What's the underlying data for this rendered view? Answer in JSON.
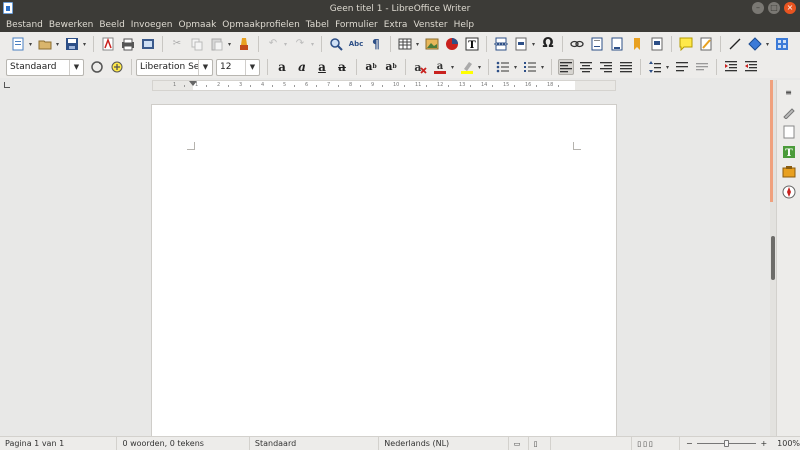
{
  "window": {
    "title": "Geen titel 1 - LibreOffice Writer",
    "controls": [
      "minimize",
      "maximize",
      "close"
    ]
  },
  "menubar": {
    "items": [
      "Bestand",
      "Bewerken",
      "Beeld",
      "Invoegen",
      "Opmaak",
      "Opmaakprofielen",
      "Tabel",
      "Formulier",
      "Extra",
      "Venster",
      "Help"
    ]
  },
  "toolbar_standard": {
    "icons": [
      "new-document-icon",
      "open-folder-icon",
      "save-icon",
      "export-pdf-icon",
      "print-icon",
      "print-preview-icon",
      "cut-icon",
      "copy-icon",
      "paste-icon",
      "clone-formatting-icon",
      "undo-icon",
      "redo-icon",
      "find-replace-icon",
      "spellcheck-icon",
      "formatting-marks-icon",
      "insert-table-icon",
      "insert-image-icon",
      "insert-chart-icon",
      "insert-textbox-icon",
      "page-break-icon",
      "insert-field-icon",
      "special-character-icon",
      "hyperlink-icon",
      "footnote-icon",
      "endnote-icon",
      "bookmark-icon",
      "cross-reference-icon",
      "comment-icon",
      "track-changes-icon",
      "line-icon",
      "basic-shapes-icon",
      "draw-functions-icon"
    ]
  },
  "toolbar_formatting": {
    "paragraph_style": "Standaard",
    "font_name": "Liberation Ser",
    "font_size": "12",
    "icons": [
      "update-style-icon",
      "new-style-icon",
      "bold-icon",
      "italic-icon",
      "underline-icon",
      "strikethrough-icon",
      "superscript-icon",
      "subscript-icon",
      "clear-formatting-icon",
      "font-color-icon",
      "highlight-icon",
      "bullets-icon",
      "numbering-icon",
      "align-left-icon",
      "align-center-icon",
      "align-right-icon",
      "justify-icon",
      "line-spacing-icon",
      "increase-paragraph-spacing-icon",
      "decrease-paragraph-spacing-icon",
      "increase-indent-icon",
      "decrease-indent-icon"
    ]
  },
  "ruler": {
    "labels": [
      "1",
      "1",
      "2",
      "3",
      "4",
      "5",
      "6",
      "7",
      "8",
      "9",
      "10",
      "11",
      "12",
      "13",
      "14",
      "15",
      "16",
      "18"
    ]
  },
  "statusbar": {
    "page": "Pagina 1 van 1",
    "words": "0 woorden, 0 tekens",
    "page_style": "Standaard",
    "language": "Nederlands (NL)",
    "zoom": "100%"
  },
  "colors": {
    "titlebar_bg": "#3c3b37",
    "close_button": "#e95420",
    "font_color_bar": "#c9211e",
    "highlight_bar": "#ffff00",
    "sidebar_accent": "#f0a17e"
  }
}
